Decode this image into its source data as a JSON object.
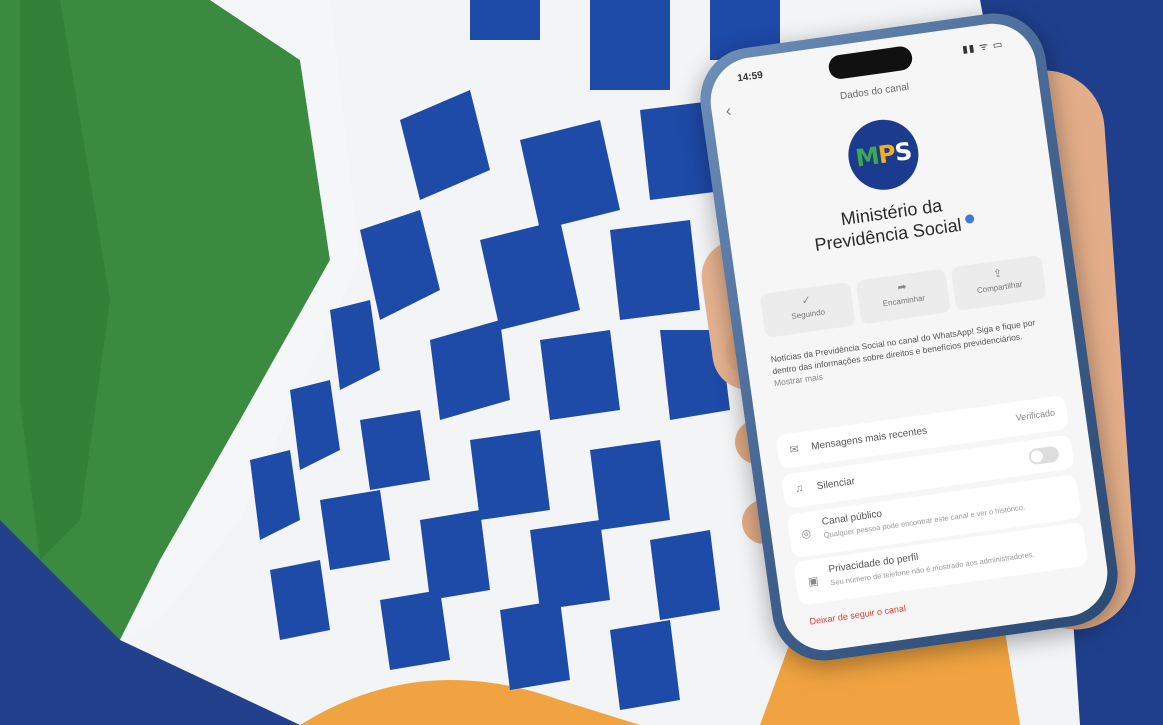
{
  "phone": {
    "status_time": "14:59",
    "status_icons": "▮▮ ᯤ ▭",
    "channel_header": "Dados do canal",
    "logo_text": "MPS",
    "org_name_line1": "Ministério da",
    "org_name_line2": "Previdência Social",
    "actions": [
      {
        "icon": "check-icon",
        "glyph": "✓",
        "label": "Seguindo"
      },
      {
        "icon": "forward-icon",
        "glyph": "➦",
        "label": "Encaminhar"
      },
      {
        "icon": "share-icon",
        "glyph": "⇪",
        "label": "Compartilhar"
      }
    ],
    "description": "Notícias da Previdência Social no canal do WhatsApp! Siga e fique por dentro das informações sobre direitos e benefícios previdenciários.",
    "description_more": "Mostrar mais",
    "settings": [
      {
        "icon": "message-icon",
        "glyph": "✉",
        "label": "Mensagens mais recentes",
        "value": "Verificado"
      },
      {
        "icon": "bell-icon",
        "glyph": "♫",
        "label": "Silenciar"
      },
      {
        "icon": "globe-icon",
        "glyph": "◎",
        "label": "Canal público",
        "subtitle": "Qualquer pessoa pode encontrar este canal e ver o histórico."
      },
      {
        "icon": "lock-icon",
        "glyph": "▣",
        "label": "Privacidade do perfil",
        "subtitle": "Seu número de telefone não é mostrado aos administradores."
      }
    ],
    "exit_label": "Deixar de seguir o canal"
  },
  "colors": {
    "flag_blue": "#1e4aa8",
    "flag_green": "#3a8a3f",
    "flag_orange": "#f0a340",
    "logo_blue": "#1a3b8e",
    "danger_red": "#d0443b"
  }
}
